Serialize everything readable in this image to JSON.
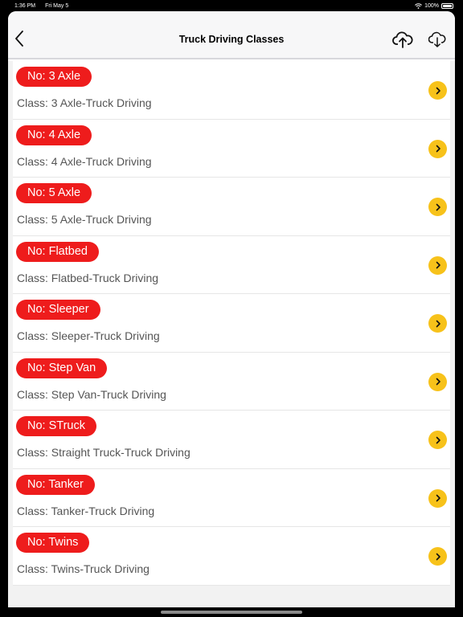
{
  "status": {
    "time": "1:36 PM",
    "date": "Fri May 5",
    "battery": "100%"
  },
  "nav": {
    "title": "Truck Driving Classes",
    "back_icon": "chevron-left-icon",
    "upload_icon": "cloud-upload-icon",
    "download_icon": "cloud-download-icon"
  },
  "colors": {
    "pill": "#ee1c1c",
    "chevron": "#f7c21a"
  },
  "items": [
    {
      "no": "No: 3 Axle",
      "class": "Class: 3 Axle-Truck Driving"
    },
    {
      "no": "No: 4 Axle",
      "class": "Class: 4 Axle-Truck Driving"
    },
    {
      "no": "No: 5 Axle",
      "class": "Class: 5 Axle-Truck Driving"
    },
    {
      "no": "No: Flatbed",
      "class": "Class: Flatbed-Truck Driving"
    },
    {
      "no": "No: Sleeper",
      "class": "Class: Sleeper-Truck Driving"
    },
    {
      "no": "No: Step Van",
      "class": "Class: Step Van-Truck Driving"
    },
    {
      "no": "No: STruck",
      "class": "Class: Straight Truck-Truck Driving"
    },
    {
      "no": "No: Tanker",
      "class": "Class: Tanker-Truck Driving"
    },
    {
      "no": "No: Twins",
      "class": "Class: Twins-Truck Driving"
    }
  ]
}
